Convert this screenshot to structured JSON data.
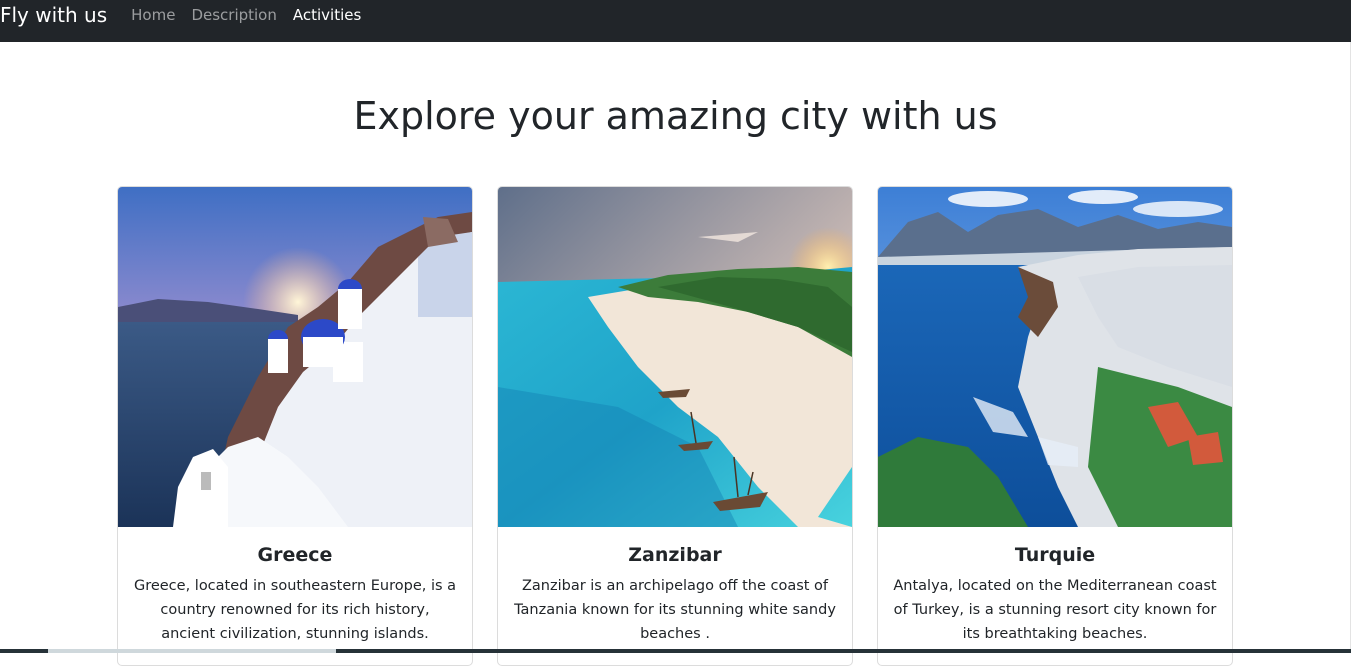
{
  "navbar": {
    "brand": "Fly with us",
    "links": [
      {
        "label": "Home",
        "active": false
      },
      {
        "label": "Description",
        "active": false
      },
      {
        "label": "Activities",
        "active": true
      }
    ]
  },
  "main": {
    "title": "Explore your amazing city with us",
    "cards": [
      {
        "title": "Greece",
        "text": "Greece, located in southeastern Europe, is a country renowned for its rich history, ancient civilization, stunning islands."
      },
      {
        "title": "Zanzibar",
        "text": "Zanzibar is an archipelago off the coast of Tanzania known for its stunning white sandy beaches ."
      },
      {
        "title": "Turquie",
        "text": "Antalya, located on the Mediterranean coast of Turkey, is a stunning resort city known for its breathtaking beaches."
      }
    ]
  },
  "colors": {
    "navbar_bg": "#212529",
    "text": "#212529"
  }
}
